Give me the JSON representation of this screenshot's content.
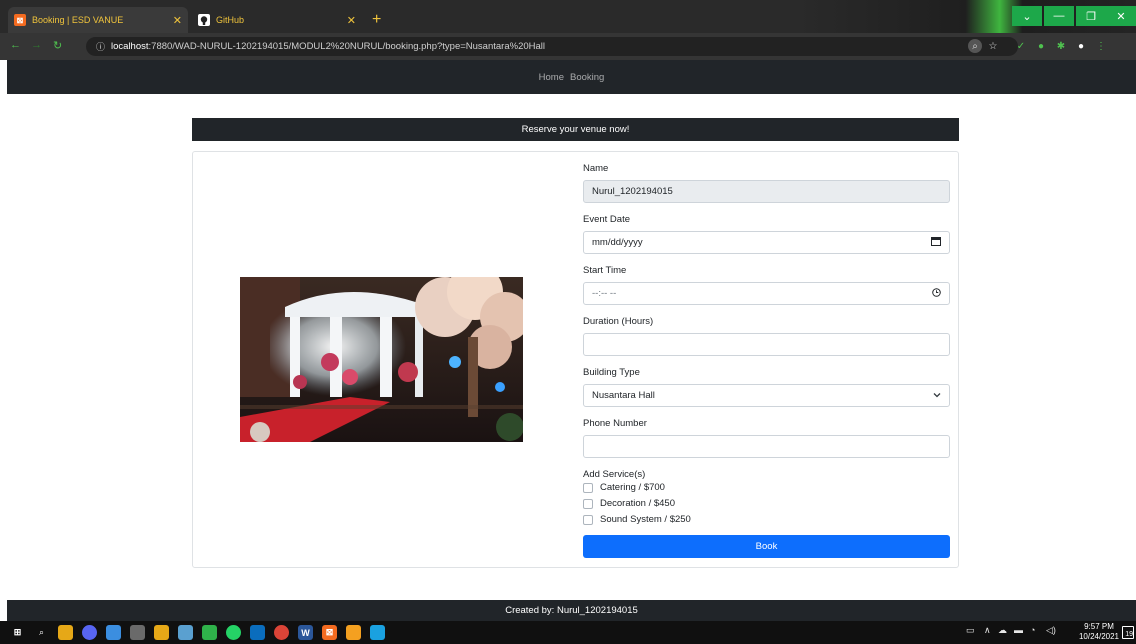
{
  "browser": {
    "tabs": [
      {
        "title": "Booking | ESD VANUE",
        "favicon": "xampp-icon",
        "active": true
      },
      {
        "title": "GitHub",
        "favicon": "github-icon",
        "active": false
      }
    ],
    "url_host": "localhost",
    "url_rest": ":7880/WAD-NURUL-1202194015/MODUL2%20NURUL/booking.php?type=Nusantara%20Hall"
  },
  "nav": {
    "links": [
      "Home",
      "Booking"
    ]
  },
  "banner": {
    "text": "Reserve your venue now!"
  },
  "form": {
    "name_label": "Name",
    "name_value": "Nurul_1202194015",
    "event_date_label": "Event Date",
    "event_date_placeholder": "mm/dd/yyyy",
    "start_time_label": "Start Time",
    "start_time_placeholder": "--:-- --",
    "duration_label": "Duration (Hours)",
    "duration_value": "",
    "building_label": "Building Type",
    "building_selected": "Nusantara Hall",
    "phone_label": "Phone Number",
    "phone_value": "",
    "services_label": "Add Service(s)",
    "services": [
      {
        "label": "Catering / $700",
        "checked": false
      },
      {
        "label": "Decoration / $450",
        "checked": false
      },
      {
        "label": "Sound System / $250",
        "checked": false
      }
    ],
    "book_label": "Book"
  },
  "footer": {
    "text": "Created by: Nurul_1202194015"
  },
  "taskbar": {
    "time": "9:57 PM",
    "date": "10/24/2021",
    "notifications": "19"
  },
  "colors": {
    "navbar": "#212529",
    "primary_button": "#0d6efd",
    "readonly_field": "#e9ecef"
  }
}
